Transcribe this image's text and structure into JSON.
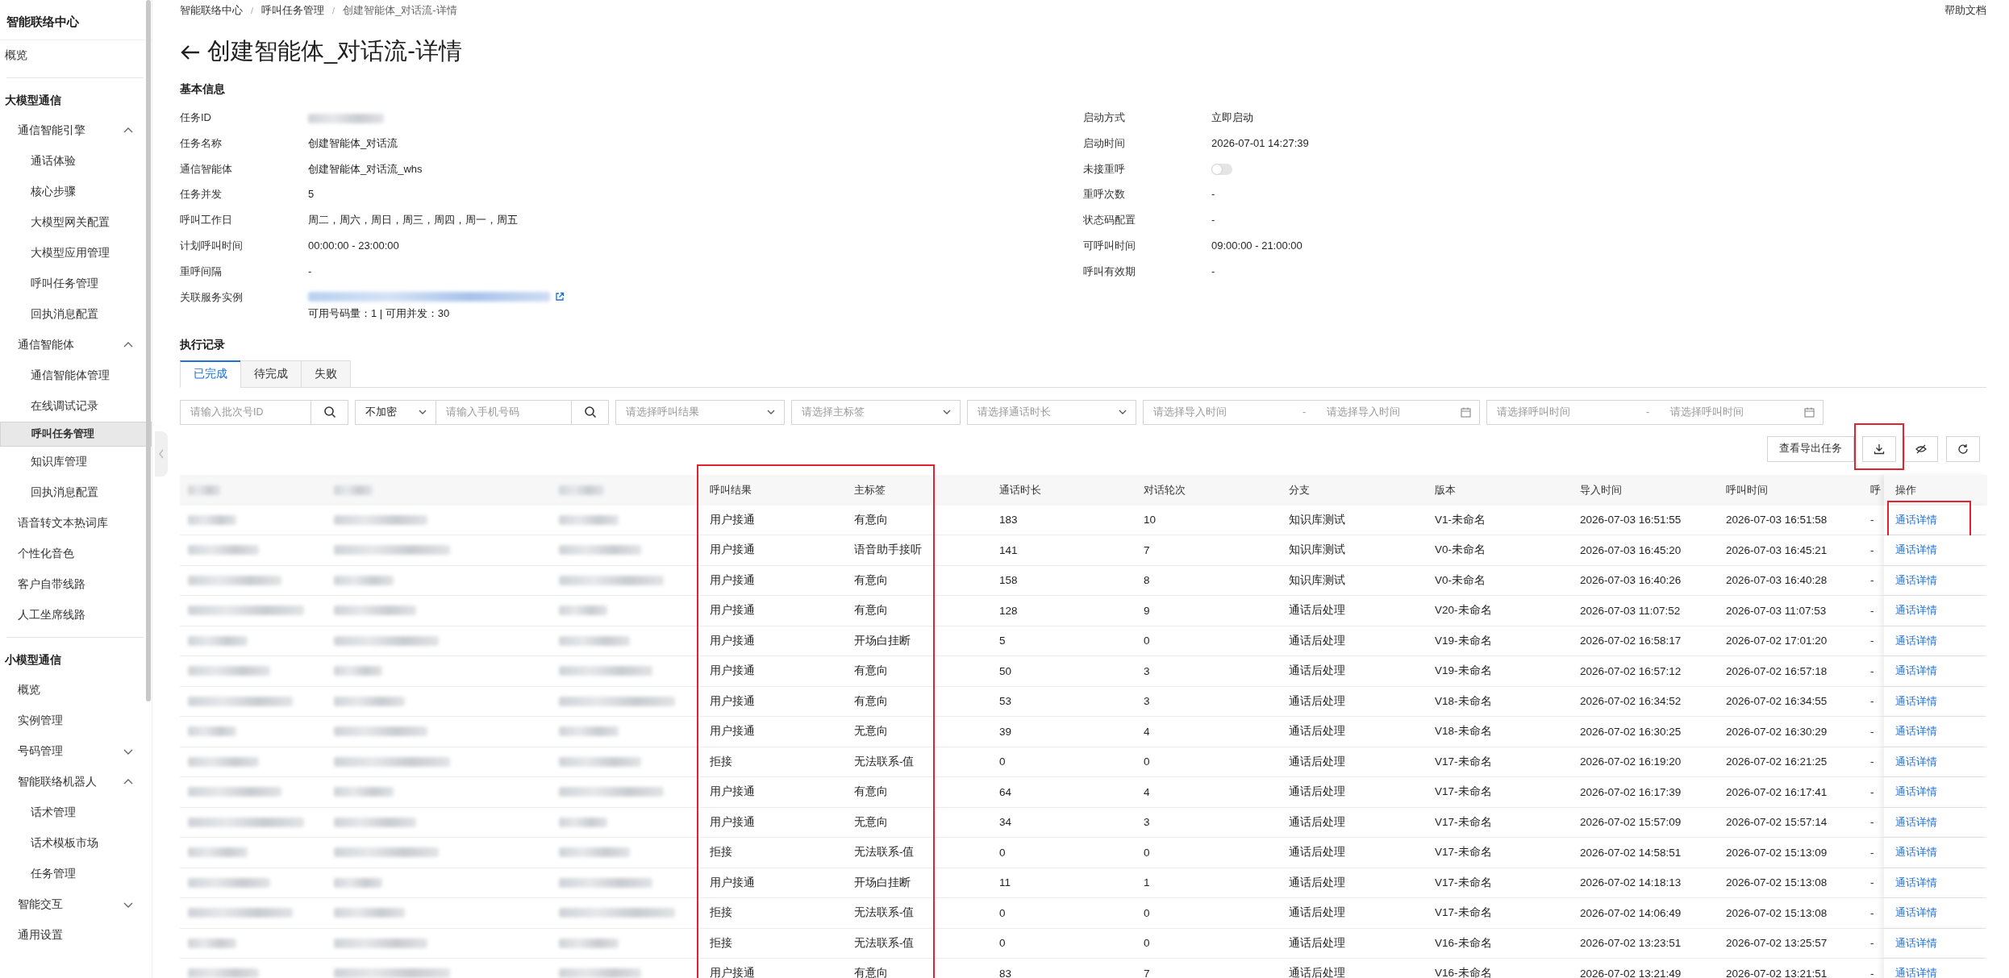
{
  "sidebar": {
    "title": "智能联络中心",
    "sections": [
      {
        "items": [
          {
            "label": "概览",
            "selected": false
          }
        ]
      },
      {
        "heading": "大模型通信",
        "items": [
          {
            "label": "通信智能引擎",
            "selected": false,
            "expanded": true,
            "children": [
              {
                "label": "通话体验",
                "selected": false
              },
              {
                "label": "核心步骤",
                "selected": false
              },
              {
                "label": "大模型网关配置",
                "selected": false
              },
              {
                "label": "大模型应用管理",
                "selected": false
              },
              {
                "label": "呼叫任务管理",
                "selected": false
              },
              {
                "label": "回执消息配置",
                "selected": false
              }
            ]
          },
          {
            "label": "通信智能体",
            "selected": false,
            "expanded": true,
            "children": [
              {
                "label": "通信智能体管理",
                "selected": false
              },
              {
                "label": "在线调试记录",
                "selected": false
              },
              {
                "label": "呼叫任务管理",
                "selected": true
              },
              {
                "label": "知识库管理",
                "selected": false
              },
              {
                "label": "回执消息配置",
                "selected": false
              }
            ]
          },
          {
            "label": "语音转文本热词库",
            "selected": false
          },
          {
            "label": "个性化音色",
            "selected": false
          },
          {
            "label": "客户自带线路",
            "selected": false
          },
          {
            "label": "人工坐席线路",
            "selected": false
          }
        ]
      },
      {
        "heading": "小模型通信",
        "items": [
          {
            "label": "概览",
            "selected": false
          },
          {
            "label": "实例管理",
            "selected": false
          },
          {
            "label": "号码管理",
            "selected": false,
            "expanded": false
          },
          {
            "label": "智能联络机器人",
            "selected": false,
            "expanded": true,
            "children": [
              {
                "label": "话术管理",
                "selected": false
              },
              {
                "label": "话术模板市场",
                "selected": false
              },
              {
                "label": "任务管理",
                "selected": false
              }
            ]
          },
          {
            "label": "智能交互",
            "selected": false,
            "expanded": false
          },
          {
            "label": "通用设置",
            "selected": false
          }
        ]
      }
    ]
  },
  "breadcrumb": [
    "智能联络中心",
    "呼叫任务管理",
    "创建智能体_对话流-详情"
  ],
  "breadcrumb_separator": "/",
  "help_link": "帮助文档",
  "page_title": "创建智能体_对话流-详情",
  "basic_info": {
    "heading": "基本信息",
    "left": [
      {
        "label": "任务ID",
        "kind": "redacted"
      },
      {
        "label": "任务名称",
        "kind": "text",
        "value": "创建智能体_对话流"
      },
      {
        "label": "通信智能体",
        "kind": "text",
        "value": "创建智能体_对话流_whs"
      },
      {
        "label": "任务并发",
        "kind": "text",
        "value": "5"
      },
      {
        "label": "呼叫工作日",
        "kind": "text",
        "value": "周二，周六，周日，周三，周四，周一，周五"
      },
      {
        "label": "计划呼叫时间",
        "kind": "text",
        "value": "00:00:00 - 23:00:00"
      },
      {
        "label": "重呼间隔",
        "kind": "text",
        "value": "-"
      },
      {
        "label": "关联服务实例",
        "kind": "redacted_link",
        "note": "可用号码量：1 | 可用并发：30"
      }
    ],
    "right": [
      {
        "label": "启动方式",
        "kind": "text",
        "value": "立即启动"
      },
      {
        "label": "启动时间",
        "kind": "text",
        "value": "2026-07-01 14:27:39"
      },
      {
        "label": "未接重呼",
        "kind": "toggle",
        "on": false
      },
      {
        "label": "重呼次数",
        "kind": "text",
        "value": "-"
      },
      {
        "label": "状态码配置",
        "kind": "text",
        "value": "-"
      },
      {
        "label": "可呼叫时间",
        "kind": "text",
        "value": "09:00:00 - 21:00:00"
      },
      {
        "label": "呼叫有效期",
        "kind": "text",
        "value": "-"
      }
    ]
  },
  "records": {
    "heading": "执行记录",
    "tabs": [
      {
        "label": "已完成",
        "selected": true
      },
      {
        "label": "待完成",
        "selected": false
      },
      {
        "label": "失败",
        "selected": false
      }
    ],
    "filters": [
      {
        "kind": "search",
        "placeholder": "请输入批次号ID"
      },
      {
        "kind": "select_search",
        "value": "不加密",
        "placeholder": "请输入手机号码"
      },
      {
        "kind": "select",
        "placeholder": "请选择呼叫结果"
      },
      {
        "kind": "select",
        "placeholder": "请选择主标签"
      },
      {
        "kind": "select",
        "placeholder": "请选择通话时长"
      },
      {
        "kind": "range",
        "start_placeholder": "请选择导入时间",
        "separator": "-",
        "end_placeholder": "请选择导入时间"
      },
      {
        "kind": "range",
        "start_placeholder": "请选择呼叫时间",
        "separator": "-",
        "end_placeholder": "请选择呼叫时间"
      }
    ],
    "export_button": "查看导出任务",
    "download_highlighted": true,
    "table": {
      "columns": [
        {
          "kind": "redacted",
          "highlighted": false
        },
        {
          "kind": "redacted",
          "highlighted": false
        },
        {
          "kind": "redacted",
          "highlighted": false
        },
        {
          "kind": "text",
          "label": "呼叫结果",
          "highlighted": true
        },
        {
          "kind": "text",
          "label": "主标签",
          "highlighted": true
        },
        {
          "kind": "text",
          "label": "通话时长",
          "highlighted": false
        },
        {
          "kind": "text",
          "label": "对话轮次",
          "highlighted": false
        },
        {
          "kind": "text",
          "label": "分支",
          "highlighted": false
        },
        {
          "kind": "text",
          "label": "版本",
          "highlighted": false
        },
        {
          "kind": "text",
          "label": "导入时间",
          "highlighted": false
        },
        {
          "kind": "text",
          "label": "呼叫时间",
          "highlighted": false
        },
        {
          "kind": "text",
          "label": "呼",
          "highlighted": false
        },
        {
          "kind": "link",
          "label": "操作",
          "highlighted": false
        }
      ],
      "rows": [
        {
          "values": [
            "用户接通",
            "有意向",
            "183",
            "10",
            "知识库测试",
            "V1-未命名",
            "2026-07-03 16:51:55",
            "2026-07-03 16:51:58",
            "-",
            "通话详情"
          ],
          "action_highlighted": true
        },
        {
          "values": [
            "用户接通",
            "语音助手接听",
            "141",
            "7",
            "知识库测试",
            "V0-未命名",
            "2026-07-03 16:45:20",
            "2026-07-03 16:45:21",
            "-",
            "通话详情"
          ],
          "action_highlighted": false
        },
        {
          "values": [
            "用户接通",
            "有意向",
            "158",
            "8",
            "知识库测试",
            "V0-未命名",
            "2026-07-03 16:40:26",
            "2026-07-03 16:40:28",
            "-",
            "通话详情"
          ],
          "action_highlighted": false
        },
        {
          "values": [
            "用户接通",
            "有意向",
            "128",
            "9",
            "通话后处理",
            "V20-未命名",
            "2026-07-03 11:07:52",
            "2026-07-03 11:07:53",
            "-",
            "通话详情"
          ],
          "action_highlighted": false
        },
        {
          "values": [
            "用户接通",
            "开场白挂断",
            "5",
            "0",
            "通话后处理",
            "V19-未命名",
            "2026-07-02 16:58:17",
            "2026-07-02 17:01:20",
            "-",
            "通话详情"
          ],
          "action_highlighted": false
        },
        {
          "values": [
            "用户接通",
            "有意向",
            "50",
            "3",
            "通话后处理",
            "V19-未命名",
            "2026-07-02 16:57:12",
            "2026-07-02 16:57:18",
            "-",
            "通话详情"
          ],
          "action_highlighted": false
        },
        {
          "values": [
            "用户接通",
            "有意向",
            "53",
            "3",
            "通话后处理",
            "V18-未命名",
            "2026-07-02 16:34:52",
            "2026-07-02 16:34:55",
            "-",
            "通话详情"
          ],
          "action_highlighted": false
        },
        {
          "values": [
            "用户接通",
            "无意向",
            "39",
            "4",
            "通话后处理",
            "V18-未命名",
            "2026-07-02 16:30:25",
            "2026-07-02 16:30:29",
            "-",
            "通话详情"
          ],
          "action_highlighted": false
        },
        {
          "values": [
            "拒接",
            "无法联系-值",
            "0",
            "0",
            "通话后处理",
            "V17-未命名",
            "2026-07-02 16:19:20",
            "2026-07-02 16:21:25",
            "-",
            "通话详情"
          ],
          "action_highlighted": false
        },
        {
          "values": [
            "用户接通",
            "有意向",
            "64",
            "4",
            "通话后处理",
            "V17-未命名",
            "2026-07-02 16:17:39",
            "2026-07-02 16:17:41",
            "-",
            "通话详情"
          ],
          "action_highlighted": false
        },
        {
          "values": [
            "用户接通",
            "无意向",
            "34",
            "3",
            "通话后处理",
            "V17-未命名",
            "2026-07-02 15:57:09",
            "2026-07-02 15:57:14",
            "-",
            "通话详情"
          ],
          "action_highlighted": false
        },
        {
          "values": [
            "拒接",
            "无法联系-值",
            "0",
            "0",
            "通话后处理",
            "V17-未命名",
            "2026-07-02 14:58:51",
            "2026-07-02 15:13:09",
            "-",
            "通话详情"
          ],
          "action_highlighted": false
        },
        {
          "values": [
            "用户接通",
            "开场白挂断",
            "11",
            "1",
            "通话后处理",
            "V17-未命名",
            "2026-07-02 14:18:13",
            "2026-07-02 15:13:08",
            "-",
            "通话详情"
          ],
          "action_highlighted": false
        },
        {
          "values": [
            "拒接",
            "无法联系-值",
            "0",
            "0",
            "通话后处理",
            "V17-未命名",
            "2026-07-02 14:06:49",
            "2026-07-02 15:13:08",
            "-",
            "通话详情"
          ],
          "action_highlighted": false
        },
        {
          "values": [
            "拒接",
            "无法联系-值",
            "0",
            "0",
            "通话后处理",
            "V16-未命名",
            "2026-07-02 13:23:51",
            "2026-07-02 13:25:57",
            "-",
            "通话详情"
          ],
          "action_highlighted": false
        },
        {
          "values": [
            "用户接通",
            "有意向",
            "83",
            "7",
            "通话后处理",
            "V16-未命名",
            "2026-07-02 13:21:49",
            "2026-07-02 13:21:51",
            "-",
            "通话详情"
          ],
          "action_highlighted": false
        }
      ]
    }
  }
}
